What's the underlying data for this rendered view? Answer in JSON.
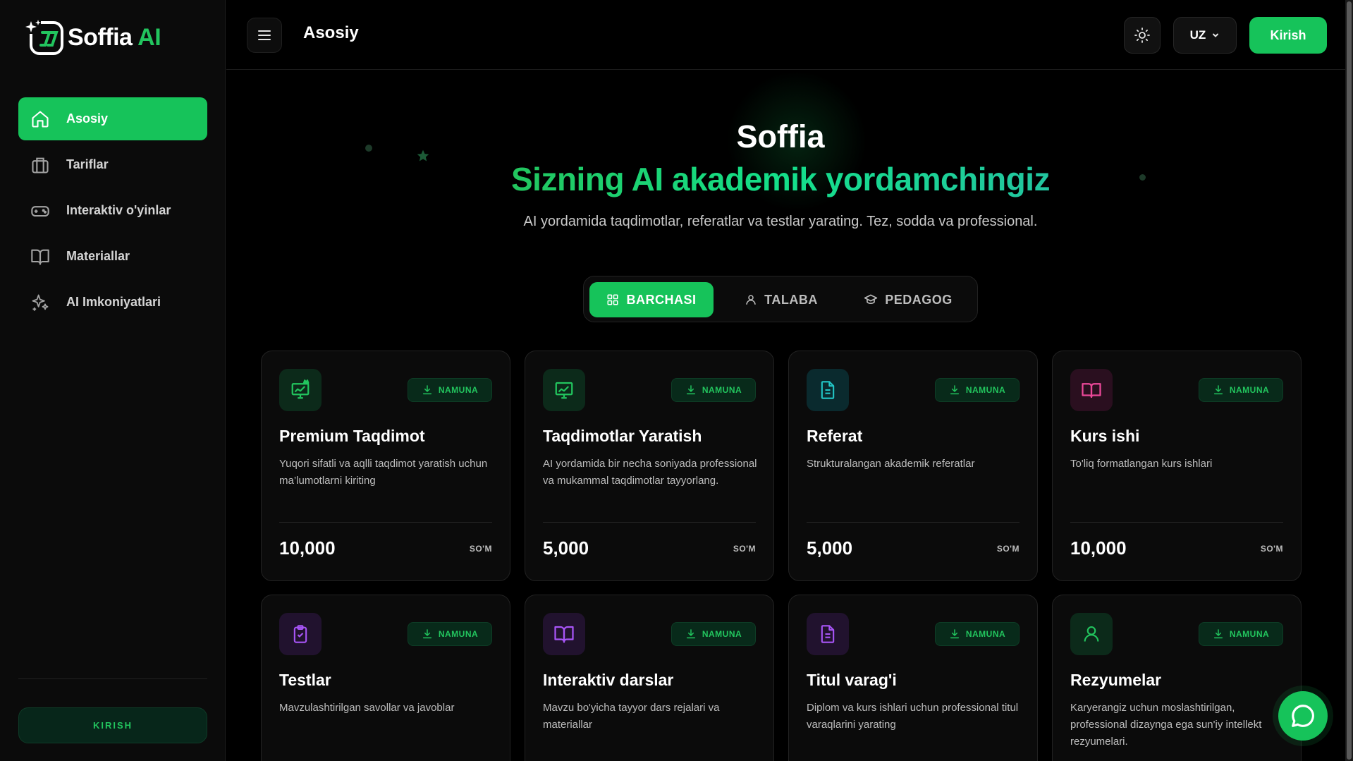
{
  "brand": {
    "name": "Soffia",
    "suffix": "AI"
  },
  "sidebar": {
    "items": [
      {
        "label": "Asosiy",
        "icon": "home-icon",
        "active": true
      },
      {
        "label": "Tariflar",
        "icon": "briefcase-icon"
      },
      {
        "label": "Interaktiv o'yinlar",
        "icon": "gamepad-icon"
      },
      {
        "label": "Materiallar",
        "icon": "book-open-icon"
      },
      {
        "label": "AI Imkoniyatlari",
        "icon": "sparkles-icon"
      }
    ],
    "login_label": "KIRISH"
  },
  "header": {
    "title": "Asosiy",
    "lang": "UZ",
    "login": "Kirish"
  },
  "hero": {
    "title": "Soffia",
    "subtitle": "Sizning AI akademik yordamchingiz",
    "description": "AI yordamida taqdimotlar, referatlar va testlar yarating. Tez, sodda va professional."
  },
  "tabs": [
    {
      "label": "BARCHASI",
      "icon": "grid-icon",
      "active": true
    },
    {
      "label": "TALABA",
      "icon": "user-icon"
    },
    {
      "label": "PEDAGOG",
      "icon": "graduation-cap-icon"
    }
  ],
  "cards": [
    {
      "title": "Premium Taqdimot",
      "desc": "Yuqori sifatli va aqlli taqdimot yaratish uchun ma’lumotlarni kiriting",
      "price": "10,000",
      "currency": "SO'M",
      "badge": "NAMUNA",
      "icon": "presentation-crown-icon",
      "color": "#22c55e",
      "bg": "#0c2a1a"
    },
    {
      "title": "Taqdimotlar Yaratish",
      "desc": "AI yordamida bir necha soniyada professional va mukammal taqdimotlar tayyorlang.",
      "price": "5,000",
      "currency": "SO'M",
      "badge": "NAMUNA",
      "icon": "presentation-icon",
      "color": "#22c55e",
      "bg": "#0c2a1a"
    },
    {
      "title": "Referat",
      "desc": "Strukturalangan akademik referatlar",
      "price": "5,000",
      "currency": "SO'M",
      "badge": "NAMUNA",
      "icon": "document-icon",
      "color": "#22c5c5",
      "bg": "#0a2a2e"
    },
    {
      "title": "Kurs ishi",
      "desc": "To'liq formatlangan kurs ishlari",
      "price": "10,000",
      "currency": "SO'M",
      "badge": "NAMUNA",
      "icon": "book-icon",
      "color": "#ec4899",
      "bg": "#2a0f1f"
    },
    {
      "title": "Testlar",
      "desc": "Mavzulashtirilgan savollar va javoblar",
      "badge": "NAMUNA",
      "icon": "clipboard-check-icon",
      "color": "#a855f7",
      "bg": "#21122e"
    },
    {
      "title": "Interaktiv darslar",
      "desc": "Mavzu bo'yicha tayyor dars rejalari va materiallar",
      "badge": "NAMUNA",
      "icon": "book-open-icon",
      "color": "#a855f7",
      "bg": "#21122e"
    },
    {
      "title": "Titul varag'i",
      "desc": "Diplom va kurs ishlari uchun professional titul varaqlarini yarating",
      "badge": "NAMUNA",
      "icon": "document-icon",
      "color": "#a855f7",
      "bg": "#21122e"
    },
    {
      "title": "Rezyumelar",
      "desc": "Karyerangiz uchun moslashtirilgan, professional dizaynga ega sun'iy intellekt rezyumelari.",
      "badge": "NAMUNA",
      "icon": "user-icon",
      "color": "#22c55e",
      "bg": "#0c2a1a"
    }
  ],
  "colors": {
    "accent": "#16c35a",
    "bg": "#000000",
    "card": "#0b0b0b"
  }
}
